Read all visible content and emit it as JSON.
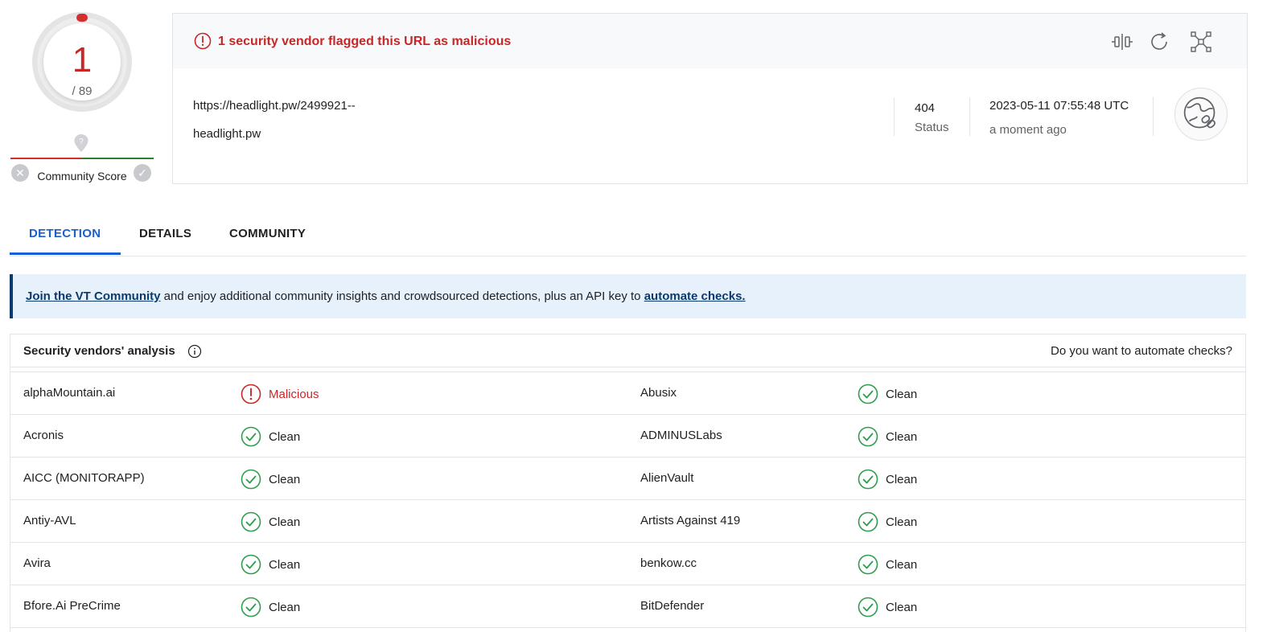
{
  "score": {
    "detections": "1",
    "total": "/ 89"
  },
  "community_score": {
    "label": "Community Score",
    "downvote": "✕",
    "upvote": "✓"
  },
  "alert": {
    "text": "1 security vendor flagged this URL as malicious"
  },
  "target": {
    "url": "https://headlight.pw/2499921--",
    "domain": "headlight.pw",
    "status_code": "404",
    "status_label": "Status",
    "date": "2023-05-11 07:55:48 UTC",
    "relative_time": "a moment ago"
  },
  "tabs": [
    {
      "label": "DETECTION",
      "active": true
    },
    {
      "label": "DETAILS",
      "active": false
    },
    {
      "label": "COMMUNITY",
      "active": false
    }
  ],
  "banner": {
    "link1": "Join the VT Community",
    "middle": " and enjoy additional community insights and crowdsourced detections, plus an API key to ",
    "link2": "automate checks."
  },
  "analysis": {
    "title": "Security vendors' analysis",
    "automate_link": "Do you want to automate checks?",
    "rows": [
      {
        "left": {
          "vendor": "alphaMountain.ai",
          "verdict": "Malicious",
          "status": "malicious"
        },
        "right": {
          "vendor": "Abusix",
          "verdict": "Clean",
          "status": "clean"
        }
      },
      {
        "left": {
          "vendor": "Acronis",
          "verdict": "Clean",
          "status": "clean"
        },
        "right": {
          "vendor": "ADMINUSLabs",
          "verdict": "Clean",
          "status": "clean"
        }
      },
      {
        "left": {
          "vendor": "AICC (MONITORAPP)",
          "verdict": "Clean",
          "status": "clean"
        },
        "right": {
          "vendor": "AlienVault",
          "verdict": "Clean",
          "status": "clean"
        }
      },
      {
        "left": {
          "vendor": "Antiy-AVL",
          "verdict": "Clean",
          "status": "clean"
        },
        "right": {
          "vendor": "Artists Against 419",
          "verdict": "Clean",
          "status": "clean"
        }
      },
      {
        "left": {
          "vendor": "Avira",
          "verdict": "Clean",
          "status": "clean"
        },
        "right": {
          "vendor": "benkow.cc",
          "verdict": "Clean",
          "status": "clean"
        }
      },
      {
        "left": {
          "vendor": "Bfore.Ai PreCrime",
          "verdict": "Clean",
          "status": "clean"
        },
        "right": {
          "vendor": "BitDefender",
          "verdict": "Clean",
          "status": "clean"
        }
      }
    ]
  },
  "colors": {
    "malicious": "#c62828",
    "clean": "#2e9d4e",
    "accent": "#1a5fd1"
  },
  "icons": [
    "alert-circle-icon",
    "compare-icon",
    "refresh-icon",
    "graph-icon",
    "globe-link-icon",
    "info-icon",
    "check-circle-icon",
    "location-pin-icon"
  ]
}
